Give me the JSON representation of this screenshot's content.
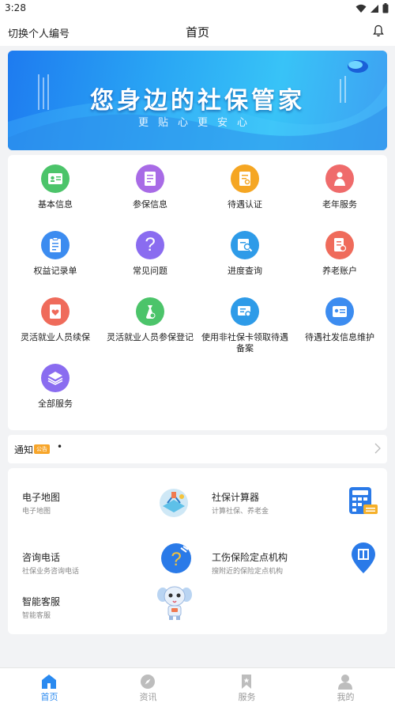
{
  "status_bar": {
    "time": "3:28",
    "icons": [
      "wifi-icon",
      "signal-icon",
      "battery-icon"
    ]
  },
  "header": {
    "left_action": "切换个人编号",
    "title": "首页",
    "right_icon": "bell-icon"
  },
  "banner": {
    "title": "您身边的社保管家",
    "subtitle": "更贴心更安心"
  },
  "services": [
    {
      "label": "基本信息",
      "icon": "id-card-icon",
      "color": "#4cc46a"
    },
    {
      "label": "参保信息",
      "icon": "insurance-doc-icon",
      "color": "#a86be6"
    },
    {
      "label": "待遇认证",
      "icon": "certify-doc-icon",
      "color": "#f5a623"
    },
    {
      "label": "老年服务",
      "icon": "elderly-icon",
      "color": "#ef6b6b"
    },
    {
      "label": "权益记录单",
      "icon": "clipboard-icon",
      "color": "#3c8cf0"
    },
    {
      "label": "常见问题",
      "icon": "question-icon",
      "color": "#8a6cf0"
    },
    {
      "label": "进度查询",
      "icon": "progress-search-icon",
      "color": "#2e9be8"
    },
    {
      "label": "养老账户",
      "icon": "pension-account-icon",
      "color": "#ef6b5b"
    },
    {
      "label": "灵活就业人员续保",
      "icon": "renew-heart-icon",
      "color": "#ef6b5b"
    },
    {
      "label": "灵活就业人员参保登记",
      "icon": "register-bag-icon",
      "color": "#4cc46a"
    },
    {
      "label": "使用非社保卡领取待遇备案",
      "icon": "card-search-icon",
      "color": "#2e9be8"
    },
    {
      "label": "待遇社发信息维护",
      "icon": "info-card-icon",
      "color": "#3c8cf0"
    },
    {
      "label": "全部服务",
      "icon": "layers-icon",
      "color": "#8a6cf0"
    }
  ],
  "notice": {
    "label": "通知",
    "tag": "公告",
    "text": "•"
  },
  "tools": [
    {
      "title": "电子地图",
      "desc": "电子地图",
      "icon": "map-illustration-icon"
    },
    {
      "title": "社保计算器",
      "desc": "计算社保、养老金",
      "icon": "calculator-icon"
    },
    {
      "title": "咨询电话",
      "desc": "社保业务咨询电话",
      "icon": "phone-question-icon"
    },
    {
      "title": "工伤保险定点机构",
      "desc": "搜附近的保险定点机构",
      "icon": "location-building-icon"
    },
    {
      "title": "智能客服",
      "desc": "智能客服",
      "icon": "robot-mascot-icon"
    }
  ],
  "nav": [
    {
      "label": "首页",
      "icon": "home-icon",
      "active": true
    },
    {
      "label": "资讯",
      "icon": "compass-icon",
      "active": false
    },
    {
      "label": "服务",
      "icon": "bookmark-icon",
      "active": false
    },
    {
      "label": "我的",
      "icon": "user-icon",
      "active": false
    }
  ],
  "colors": {
    "accent": "#2a8af0",
    "banner": "#2aa7f4",
    "notice_tag": "#f7a52a"
  }
}
